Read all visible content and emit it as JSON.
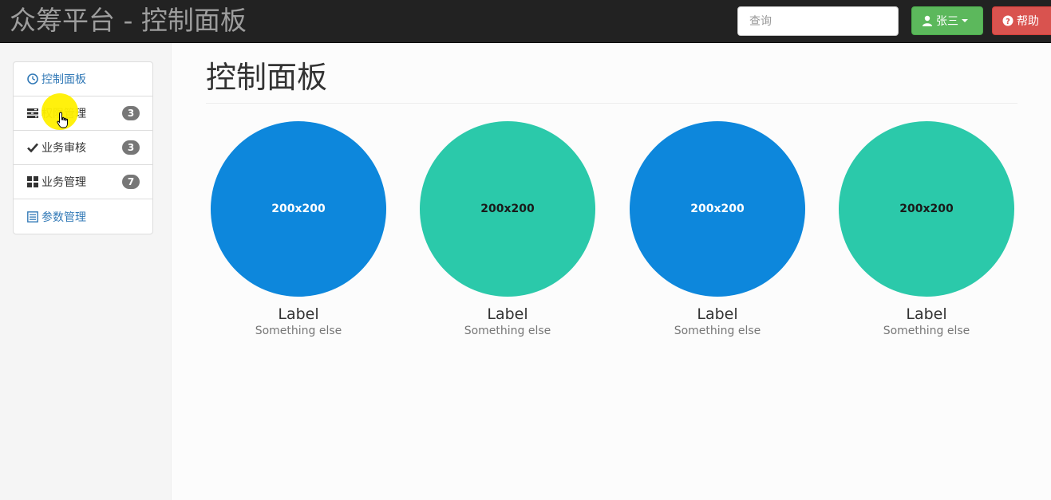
{
  "navbar": {
    "brand": "众筹平台 - 控制面板",
    "search_placeholder": "查询",
    "user_button": "张三",
    "help_button": "帮助"
  },
  "sidebar": {
    "items": [
      {
        "label": "控制面板",
        "icon": "dashboard-icon",
        "badge": ""
      },
      {
        "label": "权限管理",
        "icon": "tasks-icon",
        "badge": "3"
      },
      {
        "label": "业务审核",
        "icon": "check-icon",
        "badge": "3"
      },
      {
        "label": "业务管理",
        "icon": "th-large-icon",
        "badge": "7"
      },
      {
        "label": "参数管理",
        "icon": "list-alt-icon",
        "badge": ""
      }
    ]
  },
  "main": {
    "title": "控制面板",
    "placeholders": [
      {
        "image_text": "200x200",
        "label": "Label",
        "sub": "Something else",
        "color": "#0d87dc"
      },
      {
        "image_text": "200x200",
        "label": "Label",
        "sub": "Something else",
        "color": "#2bc9aa"
      },
      {
        "image_text": "200x200",
        "label": "Label",
        "sub": "Something else",
        "color": "#0d87dc"
      },
      {
        "image_text": "200x200",
        "label": "Label",
        "sub": "Something else",
        "color": "#2bc9aa"
      }
    ]
  },
  "colors": {
    "navbar_bg": "#222222",
    "success": "#5cb85c",
    "danger": "#d9534f",
    "link": "#337ab7",
    "badge": "#777777"
  }
}
